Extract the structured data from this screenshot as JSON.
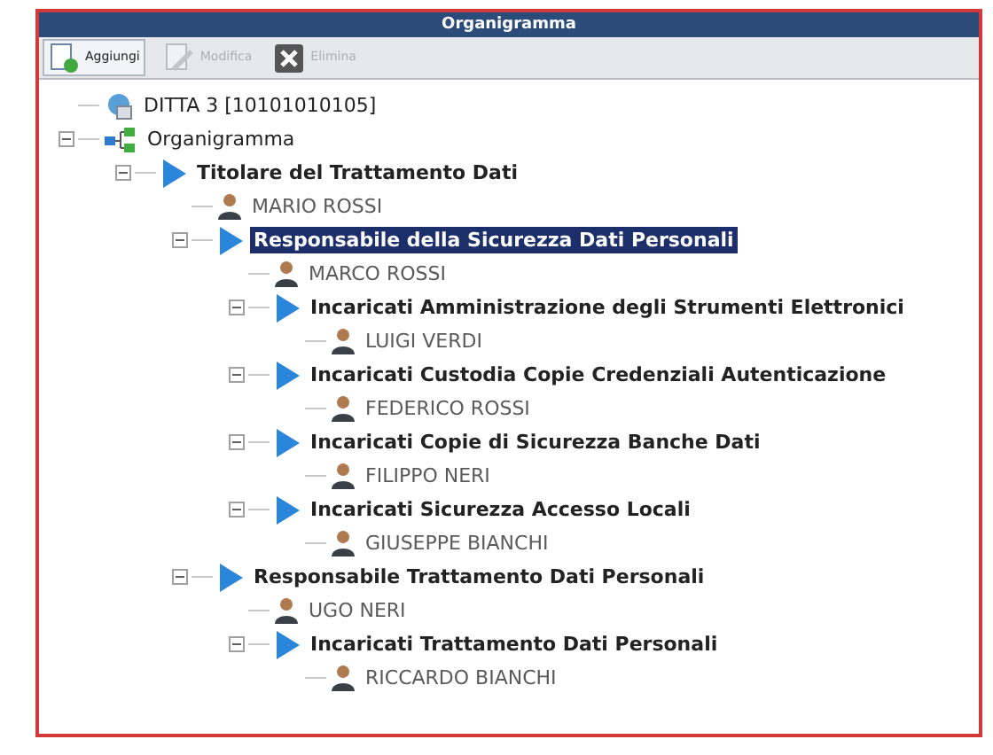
{
  "window": {
    "title": "Organigramma"
  },
  "toolbar": [
    {
      "label": "Aggiungi",
      "kind": "add",
      "disabled": false
    },
    {
      "label": "Modifica",
      "kind": "edit",
      "disabled": true
    },
    {
      "label": "Elimina",
      "kind": "delete",
      "disabled": true
    }
  ],
  "tree": [
    {
      "label": "DITTA 3 [10101010105]",
      "kind": "company",
      "selected": false
    },
    {
      "label": "Organigramma",
      "kind": "chart",
      "selected": false,
      "expanded": true,
      "children": [
        {
          "label": "Titolare del Trattamento Dati",
          "kind": "role",
          "selected": false,
          "expanded": true,
          "children": [
            {
              "label": "MARIO ROSSI",
              "kind": "person",
              "selected": false
            },
            {
              "label": "Responsabile della Sicurezza Dati Personali",
              "kind": "role",
              "selected": true,
              "expanded": true,
              "children": [
                {
                  "label": "MARCO ROSSI",
                  "kind": "person",
                  "selected": false
                },
                {
                  "label": "Incaricati Amministrazione degli Strumenti Elettronici",
                  "kind": "role",
                  "selected": false,
                  "expanded": true,
                  "children": [
                    {
                      "label": "LUIGI VERDI",
                      "kind": "person",
                      "selected": false
                    }
                  ]
                },
                {
                  "label": "Incaricati Custodia Copie Credenziali Autenticazione",
                  "kind": "role",
                  "selected": false,
                  "expanded": true,
                  "children": [
                    {
                      "label": "FEDERICO ROSSI",
                      "kind": "person",
                      "selected": false
                    }
                  ]
                },
                {
                  "label": "Incaricati Copie di Sicurezza Banche Dati",
                  "kind": "role",
                  "selected": false,
                  "expanded": true,
                  "children": [
                    {
                      "label": "FILIPPO NERI",
                      "kind": "person",
                      "selected": false
                    }
                  ]
                },
                {
                  "label": "Incaricati Sicurezza Accesso Locali",
                  "kind": "role",
                  "selected": false,
                  "expanded": true,
                  "children": [
                    {
                      "label": "GIUSEPPE BIANCHI",
                      "kind": "person",
                      "selected": false
                    }
                  ]
                }
              ]
            },
            {
              "label": "Responsabile Trattamento Dati Personali",
              "kind": "role",
              "selected": false,
              "expanded": true,
              "children": [
                {
                  "label": "UGO NERI",
                  "kind": "person",
                  "selected": false
                },
                {
                  "label": "Incaricati Trattamento Dati Personali",
                  "kind": "role",
                  "selected": false,
                  "expanded": true,
                  "children": [
                    {
                      "label": "RICCARDO BIANCHI",
                      "kind": "person",
                      "selected": false
                    }
                  ]
                }
              ]
            }
          ]
        }
      ]
    }
  ]
}
